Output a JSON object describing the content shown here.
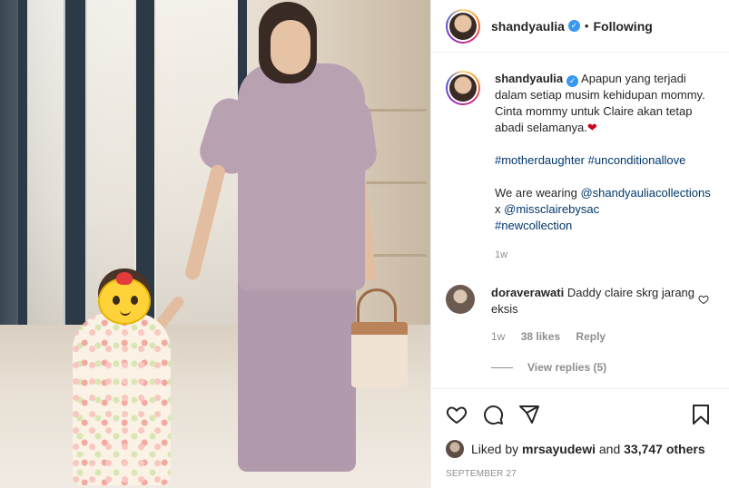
{
  "post": {
    "image_alt": "Mother and daughter walking in a mall"
  },
  "header": {
    "username": "shandyaulia",
    "separator": "•",
    "follow_status": "Following"
  },
  "caption": {
    "username": "shandyaulia",
    "line1": "Apapun yang terjadi dalam setiap musim kehidupan mommy. Cinta mommy untuk Claire akan tetap abadi selamanya.",
    "heart": "❤",
    "hashtags1": [
      "#motherdaughter",
      "#unconditionallove"
    ],
    "wearing_prefix": "We are wearing",
    "mention1": "@shandyauliacollections",
    "x_text": "x",
    "mention2": "@missclairebysac",
    "hashtag3": "#newcollection",
    "time": "1w"
  },
  "comment": {
    "username": "doraverawati",
    "text": "Daddy claire skrg jarang eksis",
    "time": "1w",
    "likes": "38 likes",
    "reply": "Reply",
    "view_replies": "View replies (5)"
  },
  "actions": {
    "liked_by_prefix": "Liked by",
    "liked_by_user": "mrsayudewi",
    "liked_by_and": "and",
    "liked_by_count": "33,747 others",
    "date": "SEPTEMBER 27"
  },
  "colors": {
    "verified": "#3897f0",
    "link": "#00376b",
    "muted": "#8e8e8e"
  }
}
